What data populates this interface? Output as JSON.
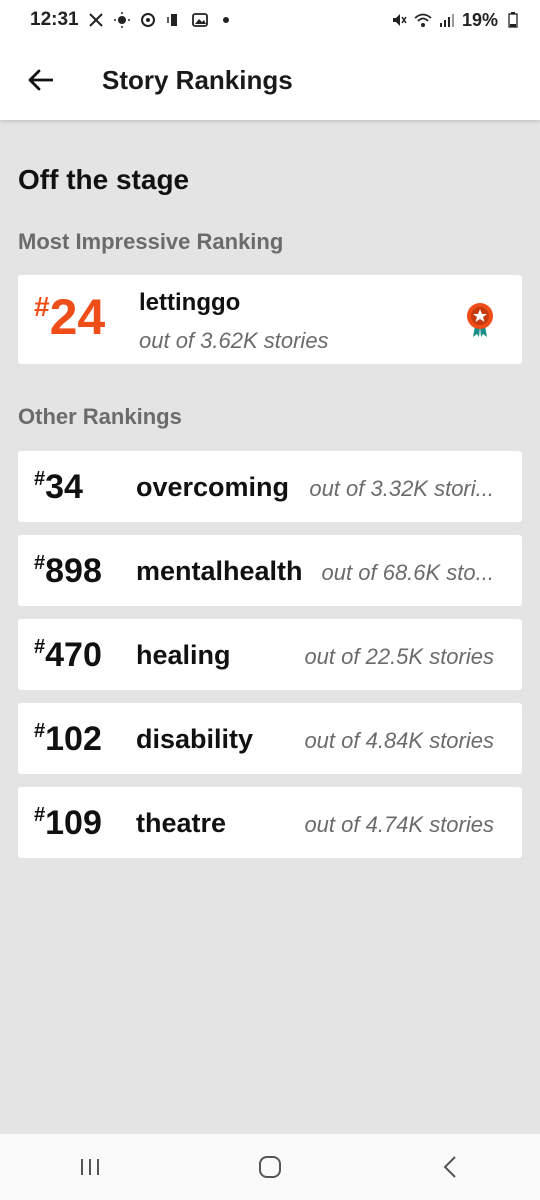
{
  "status_bar": {
    "time": "12:31",
    "battery": "19%",
    "icons_left": [
      "x-icon",
      "brightness-icon",
      "sync-icon",
      "vibrate-icon",
      "gallery-icon",
      "dot-icon"
    ],
    "icons_right": [
      "mute-icon",
      "wifi-icon",
      "signal-icon",
      "battery-icon"
    ]
  },
  "app_bar": {
    "title": "Story Rankings"
  },
  "story": {
    "title": "Off the stage"
  },
  "most_impressive": {
    "heading": "Most Impressive Ranking",
    "hash": "#",
    "rank": "24",
    "tag": "lettinggo",
    "out_of": "out of 3.62K stories",
    "accent_color": "#f04e19"
  },
  "other_rankings": {
    "heading": "Other Rankings",
    "items": [
      {
        "hash": "#",
        "rank": "34",
        "tag": "overcoming",
        "out_of": "out of 3.32K stori..."
      },
      {
        "hash": "#",
        "rank": "898",
        "tag": "mentalhealth",
        "out_of": "out of 68.6K sto..."
      },
      {
        "hash": "#",
        "rank": "470",
        "tag": "healing",
        "out_of": "out of 22.5K stories"
      },
      {
        "hash": "#",
        "rank": "102",
        "tag": "disability",
        "out_of": "out of 4.84K stories"
      },
      {
        "hash": "#",
        "rank": "109",
        "tag": "theatre",
        "out_of": "out of 4.74K stories"
      }
    ]
  },
  "nav_bar": {
    "buttons": [
      "recent-apps-icon",
      "home-icon",
      "back-nav-icon"
    ]
  }
}
